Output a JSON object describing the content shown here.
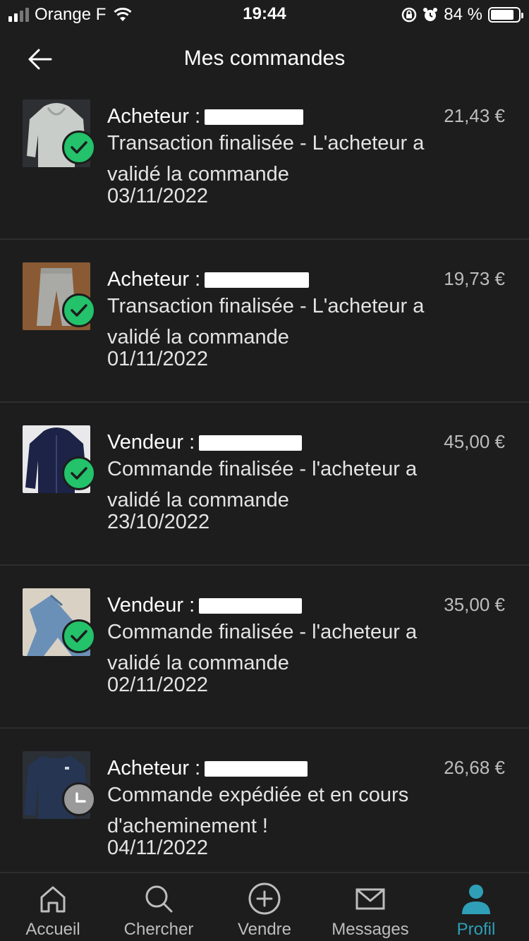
{
  "status_bar": {
    "carrier": "Orange F",
    "time": "19:44",
    "battery_percent": "84 %",
    "battery_level": 0.84
  },
  "header": {
    "title": "Mes commandes"
  },
  "orders": [
    {
      "role": "Acheteur :",
      "price": "21,43 €",
      "status_line1": "Transaction finalisée - L'acheteur a",
      "status_line2": "validé la commande",
      "date": "03/11/2022",
      "state": "completed",
      "item": "grey hoodie"
    },
    {
      "role": "Acheteur :",
      "price": "19,73 €",
      "status_line1": "Transaction finalisée - L'acheteur a",
      "status_line2": "validé la commande",
      "date": "01/11/2022",
      "state": "completed",
      "item": "grey joggers"
    },
    {
      "role": "Vendeur :",
      "price": "45,00 €",
      "status_line1": "Commande finalisée - l'acheteur a",
      "status_line2": "validé la commande",
      "date": "23/10/2022",
      "state": "completed",
      "item": "navy zip hoodie"
    },
    {
      "role": "Vendeur :",
      "price": "35,00 €",
      "status_line1": "Commande finalisée - l'acheteur a",
      "status_line2": "validé la commande",
      "date": "02/11/2022",
      "state": "completed",
      "item": "blue jeans"
    },
    {
      "role": "Acheteur :",
      "price": "26,68 €",
      "status_line1": "Commande expédiée et en cours",
      "status_line2": "d'acheminement !",
      "date": "04/11/2022",
      "state": "in-transit",
      "item": "navy sweater"
    }
  ],
  "bottom_nav": {
    "items": [
      {
        "label": "Accueil",
        "icon": "home-icon"
      },
      {
        "label": "Chercher",
        "icon": "search-icon"
      },
      {
        "label": "Vendre",
        "icon": "plus-circle-icon"
      },
      {
        "label": "Messages",
        "icon": "mail-icon"
      },
      {
        "label": "Profil",
        "icon": "profile-icon",
        "active": true
      }
    ]
  },
  "colors": {
    "background": "#1d1d1d",
    "accent": "#2f9fb8",
    "success": "#23c26b"
  }
}
